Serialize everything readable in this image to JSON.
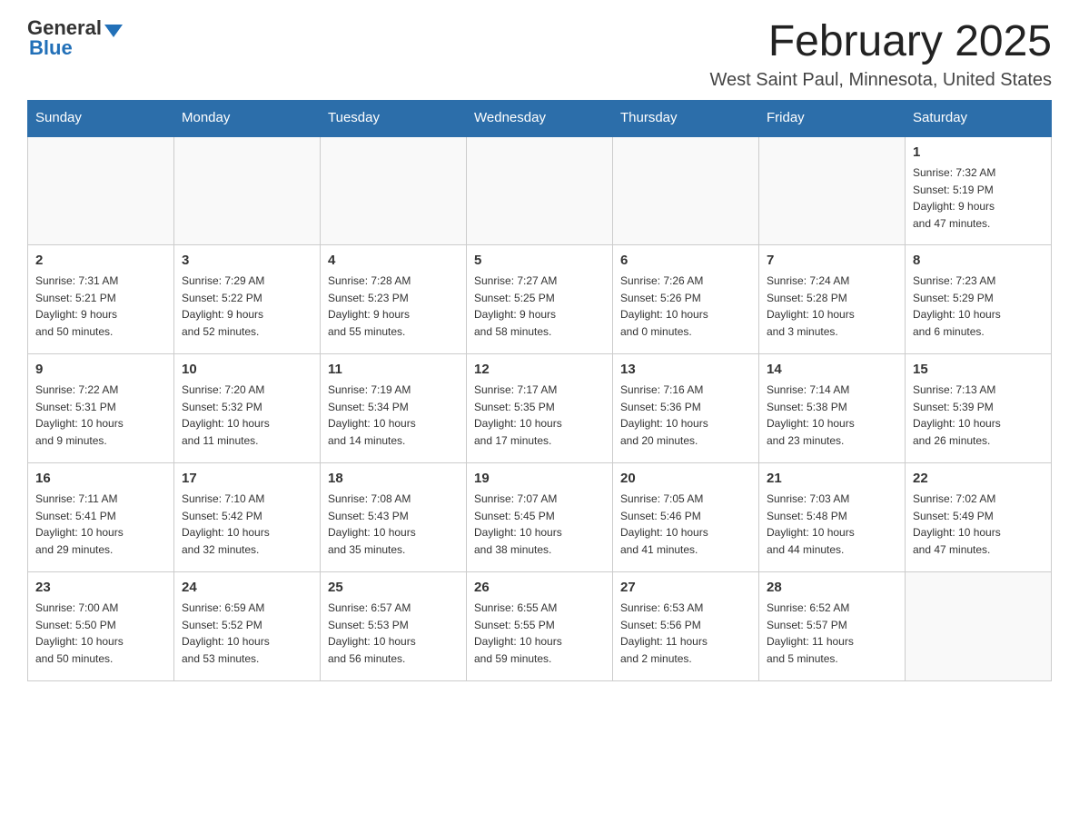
{
  "header": {
    "logo_general": "General",
    "logo_blue": "Blue",
    "title": "February 2025",
    "subtitle": "West Saint Paul, Minnesota, United States"
  },
  "days_of_week": [
    "Sunday",
    "Monday",
    "Tuesday",
    "Wednesday",
    "Thursday",
    "Friday",
    "Saturday"
  ],
  "weeks": [
    [
      {
        "day": "",
        "info": ""
      },
      {
        "day": "",
        "info": ""
      },
      {
        "day": "",
        "info": ""
      },
      {
        "day": "",
        "info": ""
      },
      {
        "day": "",
        "info": ""
      },
      {
        "day": "",
        "info": ""
      },
      {
        "day": "1",
        "info": "Sunrise: 7:32 AM\nSunset: 5:19 PM\nDaylight: 9 hours\nand 47 minutes."
      }
    ],
    [
      {
        "day": "2",
        "info": "Sunrise: 7:31 AM\nSunset: 5:21 PM\nDaylight: 9 hours\nand 50 minutes."
      },
      {
        "day": "3",
        "info": "Sunrise: 7:29 AM\nSunset: 5:22 PM\nDaylight: 9 hours\nand 52 minutes."
      },
      {
        "day": "4",
        "info": "Sunrise: 7:28 AM\nSunset: 5:23 PM\nDaylight: 9 hours\nand 55 minutes."
      },
      {
        "day": "5",
        "info": "Sunrise: 7:27 AM\nSunset: 5:25 PM\nDaylight: 9 hours\nand 58 minutes."
      },
      {
        "day": "6",
        "info": "Sunrise: 7:26 AM\nSunset: 5:26 PM\nDaylight: 10 hours\nand 0 minutes."
      },
      {
        "day": "7",
        "info": "Sunrise: 7:24 AM\nSunset: 5:28 PM\nDaylight: 10 hours\nand 3 minutes."
      },
      {
        "day": "8",
        "info": "Sunrise: 7:23 AM\nSunset: 5:29 PM\nDaylight: 10 hours\nand 6 minutes."
      }
    ],
    [
      {
        "day": "9",
        "info": "Sunrise: 7:22 AM\nSunset: 5:31 PM\nDaylight: 10 hours\nand 9 minutes."
      },
      {
        "day": "10",
        "info": "Sunrise: 7:20 AM\nSunset: 5:32 PM\nDaylight: 10 hours\nand 11 minutes."
      },
      {
        "day": "11",
        "info": "Sunrise: 7:19 AM\nSunset: 5:34 PM\nDaylight: 10 hours\nand 14 minutes."
      },
      {
        "day": "12",
        "info": "Sunrise: 7:17 AM\nSunset: 5:35 PM\nDaylight: 10 hours\nand 17 minutes."
      },
      {
        "day": "13",
        "info": "Sunrise: 7:16 AM\nSunset: 5:36 PM\nDaylight: 10 hours\nand 20 minutes."
      },
      {
        "day": "14",
        "info": "Sunrise: 7:14 AM\nSunset: 5:38 PM\nDaylight: 10 hours\nand 23 minutes."
      },
      {
        "day": "15",
        "info": "Sunrise: 7:13 AM\nSunset: 5:39 PM\nDaylight: 10 hours\nand 26 minutes."
      }
    ],
    [
      {
        "day": "16",
        "info": "Sunrise: 7:11 AM\nSunset: 5:41 PM\nDaylight: 10 hours\nand 29 minutes."
      },
      {
        "day": "17",
        "info": "Sunrise: 7:10 AM\nSunset: 5:42 PM\nDaylight: 10 hours\nand 32 minutes."
      },
      {
        "day": "18",
        "info": "Sunrise: 7:08 AM\nSunset: 5:43 PM\nDaylight: 10 hours\nand 35 minutes."
      },
      {
        "day": "19",
        "info": "Sunrise: 7:07 AM\nSunset: 5:45 PM\nDaylight: 10 hours\nand 38 minutes."
      },
      {
        "day": "20",
        "info": "Sunrise: 7:05 AM\nSunset: 5:46 PM\nDaylight: 10 hours\nand 41 minutes."
      },
      {
        "day": "21",
        "info": "Sunrise: 7:03 AM\nSunset: 5:48 PM\nDaylight: 10 hours\nand 44 minutes."
      },
      {
        "day": "22",
        "info": "Sunrise: 7:02 AM\nSunset: 5:49 PM\nDaylight: 10 hours\nand 47 minutes."
      }
    ],
    [
      {
        "day": "23",
        "info": "Sunrise: 7:00 AM\nSunset: 5:50 PM\nDaylight: 10 hours\nand 50 minutes."
      },
      {
        "day": "24",
        "info": "Sunrise: 6:59 AM\nSunset: 5:52 PM\nDaylight: 10 hours\nand 53 minutes."
      },
      {
        "day": "25",
        "info": "Sunrise: 6:57 AM\nSunset: 5:53 PM\nDaylight: 10 hours\nand 56 minutes."
      },
      {
        "day": "26",
        "info": "Sunrise: 6:55 AM\nSunset: 5:55 PM\nDaylight: 10 hours\nand 59 minutes."
      },
      {
        "day": "27",
        "info": "Sunrise: 6:53 AM\nSunset: 5:56 PM\nDaylight: 11 hours\nand 2 minutes."
      },
      {
        "day": "28",
        "info": "Sunrise: 6:52 AM\nSunset: 5:57 PM\nDaylight: 11 hours\nand 5 minutes."
      },
      {
        "day": "",
        "info": ""
      }
    ]
  ]
}
